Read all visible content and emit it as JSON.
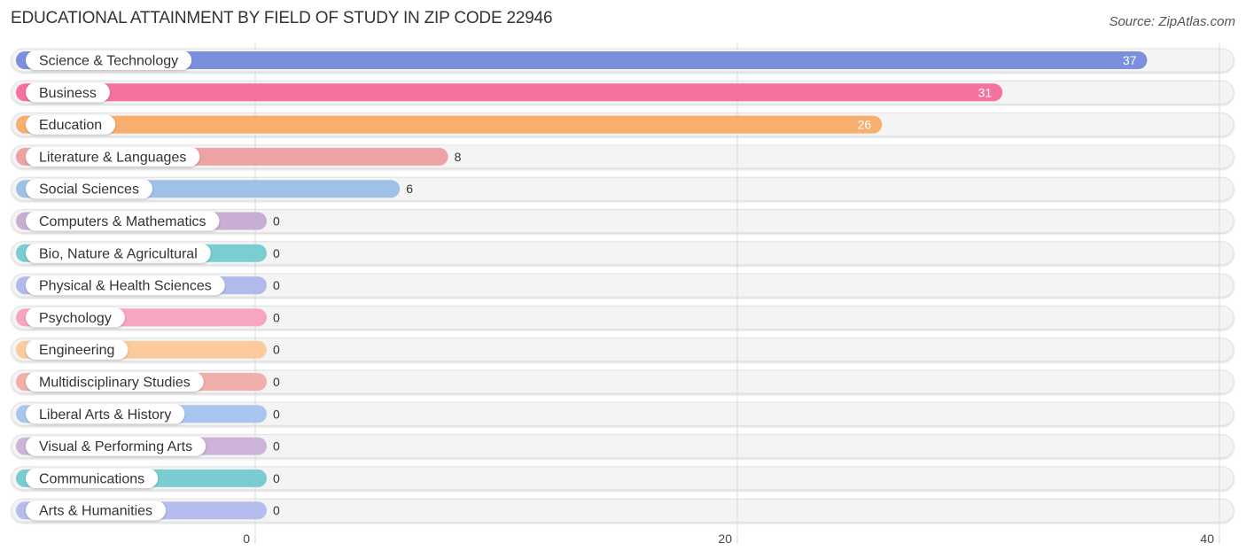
{
  "header": {
    "title": "EDUCATIONAL ATTAINMENT BY FIELD OF STUDY IN ZIP CODE 22946",
    "source": "Source: ZipAtlas.com"
  },
  "chart_data": {
    "type": "bar",
    "orientation": "horizontal",
    "title": "EDUCATIONAL ATTAINMENT BY FIELD OF STUDY IN ZIP CODE 22946",
    "xlabel": "",
    "ylabel": "",
    "xlim": [
      0,
      40
    ],
    "ticks": [
      0,
      20,
      40
    ],
    "tick_labels": [
      "0",
      "20",
      "40"
    ],
    "grid": true,
    "categories": [
      "Science & Technology",
      "Business",
      "Education",
      "Literature & Languages",
      "Social Sciences",
      "Computers & Mathematics",
      "Bio, Nature & Agricultural",
      "Physical & Health Sciences",
      "Psychology",
      "Engineering",
      "Multidisciplinary Studies",
      "Liberal Arts & History",
      "Visual & Performing Arts",
      "Communications",
      "Arts & Humanities"
    ],
    "values": [
      37,
      31,
      26,
      8,
      6,
      0,
      0,
      0,
      0,
      0,
      0,
      0,
      0,
      0,
      0
    ],
    "value_labels": [
      "37",
      "31",
      "26",
      "8",
      "6",
      "0",
      "0",
      "0",
      "0",
      "0",
      "0",
      "0",
      "0",
      "0",
      "0"
    ],
    "colors": [
      "#7b8fdc",
      "#f4729c",
      "#f8af6e",
      "#eda3a3",
      "#9fc1e7",
      "#c9aed4",
      "#7acdd2",
      "#b2baec",
      "#f7a5c1",
      "#fbcb9d",
      "#f1afab",
      "#a9c6ee",
      "#cdb3d7",
      "#7accd1",
      "#b5bdec"
    ]
  }
}
